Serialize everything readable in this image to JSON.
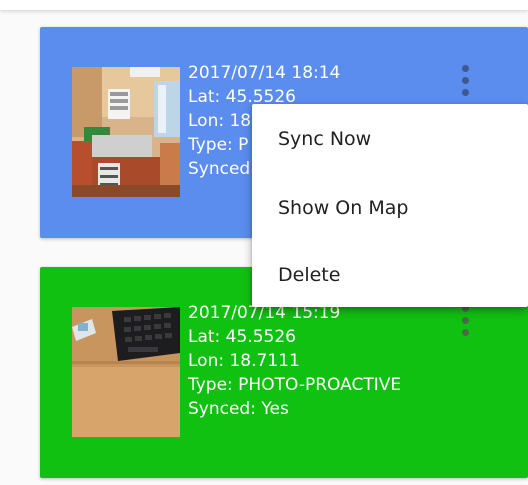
{
  "colors": {
    "card_unsynced": "#5b8def",
    "card_synced": "#11c111",
    "menu_bg": "#ffffff",
    "menu_text": "#212121",
    "dots_unsynced": "#3d5a8f",
    "dots_synced": "#4a6a4a"
  },
  "entries": [
    {
      "datetime": "2017/07/14 18:14",
      "lat": "Lat: 45.5526",
      "lon": "Lon: 18",
      "type": "Type: P",
      "synced": "Synced",
      "more_icon": "more-vert-icon",
      "thumbnail": "room-photo"
    },
    {
      "datetime": "2017/07/14 15:19",
      "lat": "Lat: 45.5526",
      "lon": "Lon: 18.7111",
      "type": "Type: PHOTO-PROACTIVE",
      "synced": "Synced: Yes",
      "more_icon": "more-vert-icon",
      "thumbnail": "keyboard-desk-photo"
    }
  ],
  "context_menu": {
    "items": [
      "Sync Now",
      "Show On Map",
      "Delete"
    ]
  }
}
